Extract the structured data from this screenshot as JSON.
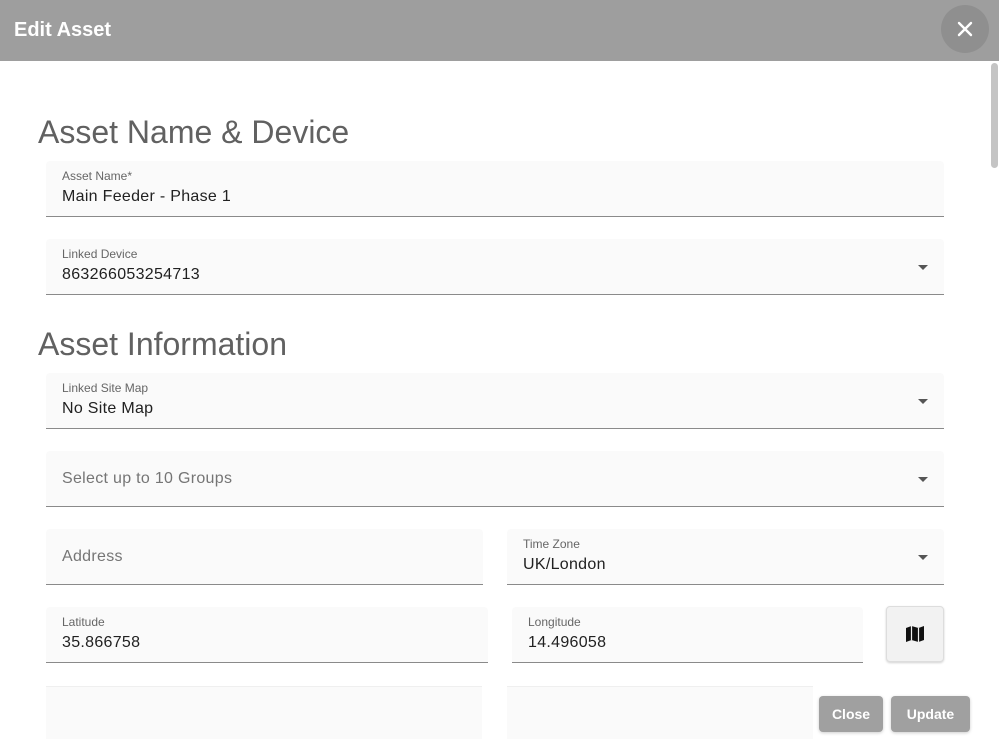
{
  "dialog": {
    "title": "Edit Asset"
  },
  "sections": {
    "name_device": "Asset Name & Device",
    "information": "Asset Information"
  },
  "fields": {
    "asset_name": {
      "label": "Asset Name*",
      "value": "Main Feeder - Phase 1"
    },
    "linked_device": {
      "label": "Linked Device",
      "value": "863266053254713"
    },
    "linked_site_map": {
      "label": "Linked Site Map",
      "value": "No Site Map"
    },
    "groups": {
      "placeholder": "Select up to 10 Groups"
    },
    "address": {
      "placeholder": "Address"
    },
    "time_zone": {
      "label": "Time Zone",
      "value": "UK/London"
    },
    "latitude": {
      "label": "Latitude",
      "value": "35.866758"
    },
    "longitude": {
      "label": "Longitude",
      "value": "14.496058"
    }
  },
  "actions": {
    "close": "Close",
    "update": "Update"
  },
  "icons": {
    "dialog_close": "close-icon",
    "map": "map-icon"
  },
  "colors": {
    "header": "#9e9e9e",
    "button": "#a0a0a0",
    "field_bg": "#fafafa"
  }
}
